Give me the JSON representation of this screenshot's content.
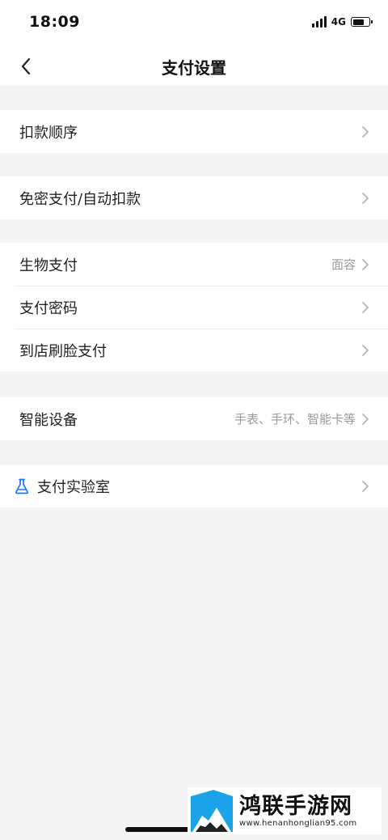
{
  "status": {
    "time": "18:09",
    "network": "4G"
  },
  "nav": {
    "title": "支付设置"
  },
  "groups": [
    {
      "items": [
        {
          "label": "扣款顺序",
          "value": ""
        }
      ]
    },
    {
      "items": [
        {
          "label": "免密支付/自动扣款",
          "value": ""
        }
      ]
    },
    {
      "items": [
        {
          "label": "生物支付",
          "value": "面容"
        },
        {
          "label": "支付密码",
          "value": ""
        },
        {
          "label": "到店刷脸支付",
          "value": ""
        }
      ]
    },
    {
      "items": [
        {
          "label": "智能设备",
          "value": "手表、手环、智能卡等"
        }
      ]
    },
    {
      "items": [
        {
          "label": "支付实验室",
          "value": "",
          "icon": "flask-icon"
        }
      ]
    }
  ],
  "watermark": {
    "title": "鸿联手游网",
    "url": "www.henanhonglian95.com"
  },
  "colors": {
    "background": "#f4f4f4",
    "card": "#ffffff",
    "accent_icon": "#1677ff",
    "secondary_text": "#9a9a9a"
  }
}
